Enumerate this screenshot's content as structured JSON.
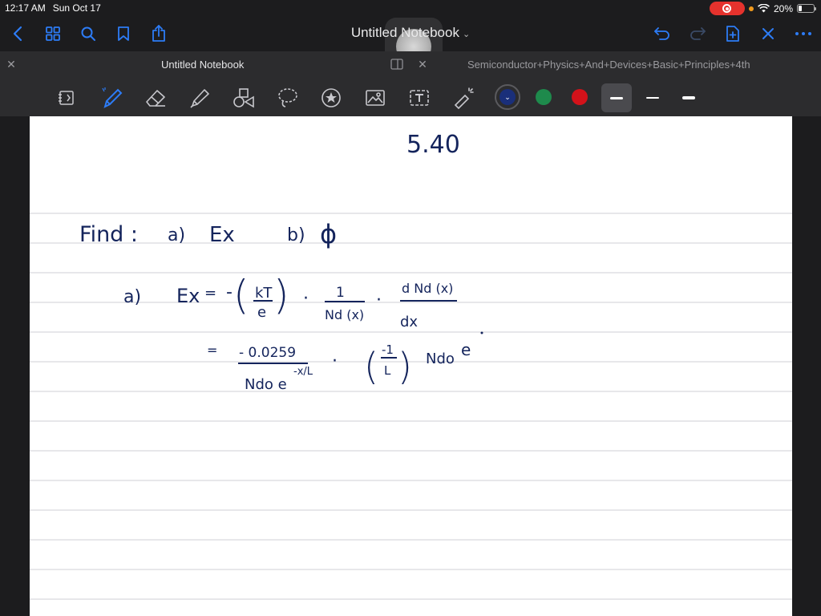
{
  "status_bar": {
    "time": "12:17 AM",
    "date": "Sun Oct 17",
    "battery": "20%",
    "battery_level": 0.2
  },
  "nav_bar": {
    "title": "Untitled Notebook",
    "title_chevron": "⌄",
    "left_icons": [
      "back-chevron-icon",
      "grid-icon",
      "search-icon",
      "bookmark-icon",
      "share-icon"
    ],
    "right_icons": [
      "undo-icon",
      "redo-icon",
      "add-page-icon",
      "close-icon",
      "more-icon"
    ]
  },
  "tabs": [
    {
      "label": "Untitled Notebook",
      "active": true
    },
    {
      "label": "Semiconductor+Physics+And+Devices+Basic+Principles+4th",
      "active": false
    }
  ],
  "toolbar": {
    "tools": [
      "reader-icon",
      "pen-icon",
      "eraser-icon",
      "highlighter-icon",
      "shapes-icon",
      "lasso-icon",
      "sticker-icon",
      "image-icon",
      "text-box-icon",
      "laser-pointer-icon"
    ],
    "colors": [
      "#1a2f7a",
      "#1e8a4c",
      "#d3121a"
    ],
    "selected_color": "#1a2f7a",
    "stroke_widths": [
      "thick",
      "thin",
      "medium"
    ],
    "selected_stroke": "thick"
  },
  "page": {
    "handwriting": {
      "problem_number": "5.40",
      "find_prefix": "Find :",
      "part_a_label": "a)",
      "part_a_target": "Ex",
      "part_b_label": "b)",
      "part_b_target": "ϕ",
      "line1_label": "a)",
      "line1_lhs": "Ex",
      "line1_eq": "=",
      "line1_minus": "-",
      "line1_kt": "kT",
      "line1_e": "e",
      "line1_dot1": "·",
      "line1_one": "1",
      "line1_nd": "Nd (x)",
      "line1_dot2": "·",
      "line1_dnd": "d Nd (x)",
      "line1_dx": "dx",
      "line2_eq": "=",
      "line2_num": "- 0.0259",
      "line2_den": "Ndo e",
      "line2_exp": "-x/L",
      "line2_dot": "·",
      "line2_paren_num": "-1",
      "line2_paren_den": "L",
      "line2_ndo": "Ndo",
      "line2_e": "e"
    }
  }
}
